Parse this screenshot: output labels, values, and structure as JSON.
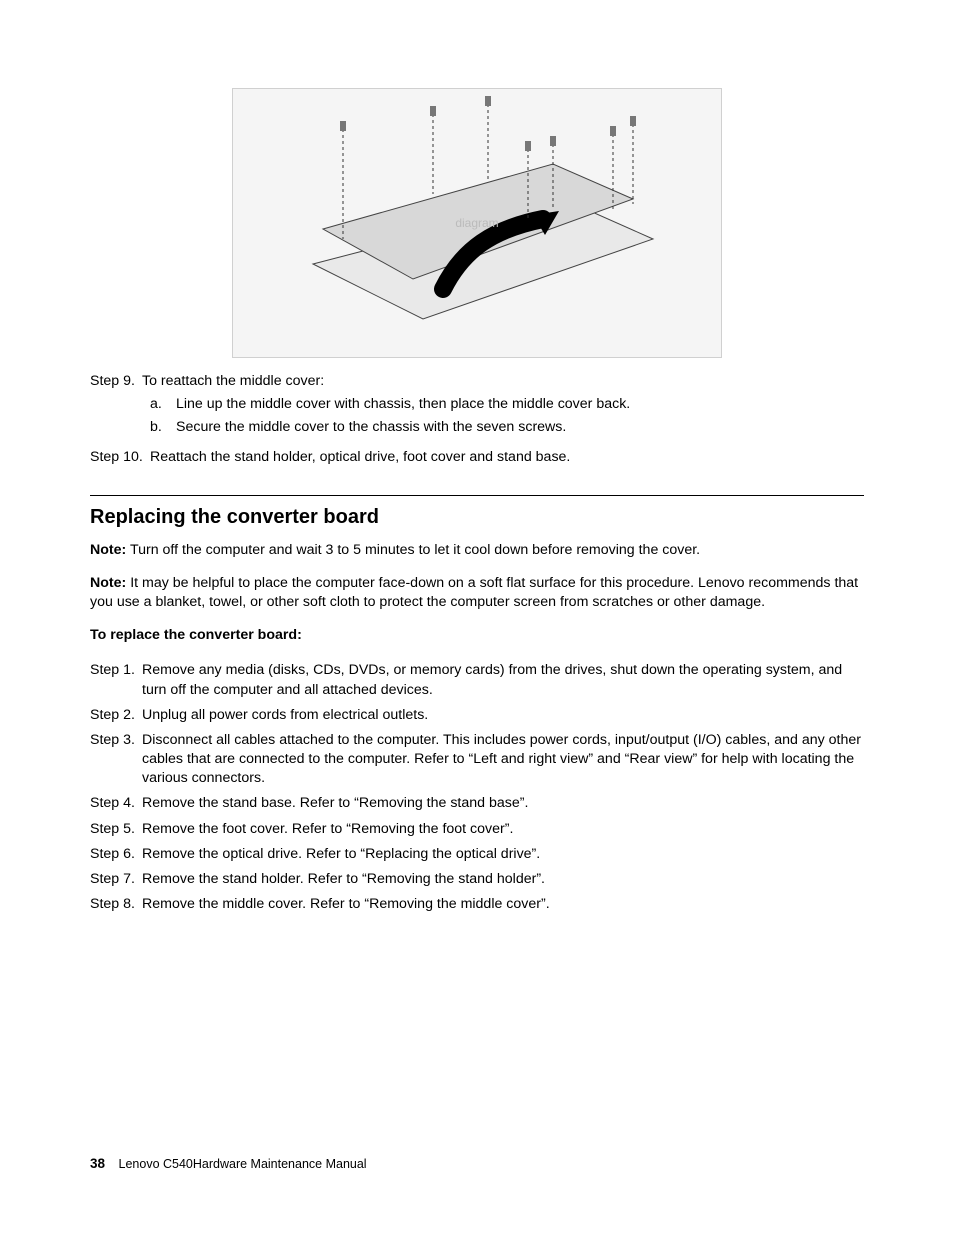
{
  "top_steps": [
    {
      "label": "Step 9.",
      "text": "To reattach the middle cover:",
      "subs": [
        {
          "label": "a.",
          "text": "Line up the middle cover with chassis, then place the middle cover back."
        },
        {
          "label": "b.",
          "text": "Secure the middle cover to the chassis with the seven screws."
        }
      ]
    },
    {
      "label": "Step 10.",
      "text": "Reattach the stand holder, optical drive, foot cover and stand base.",
      "subs": []
    }
  ],
  "section_heading": "Replacing the converter board",
  "note_label": "Note:",
  "note1": "Turn off the computer and wait 3 to 5 minutes to let it cool down before removing the cover.",
  "note2": "It may be helpful to place the computer face-down on a soft flat surface for this procedure. Lenovo recommends that you use a blanket, towel, or other soft cloth to protect the computer screen from scratches or other damage.",
  "subheading": "To replace the converter board:",
  "bottom_steps": [
    {
      "label": "Step 1.",
      "text": "Remove any media (disks, CDs, DVDs, or memory cards) from the drives, shut down the operating system, and turn off the computer and all attached devices."
    },
    {
      "label": "Step 2.",
      "text": "Unplug all power cords from electrical outlets."
    },
    {
      "label": "Step 3.",
      "text": "Disconnect all cables attached to the computer. This includes power cords, input/output (I/O) cables, and any other cables that are connected to the computer. Refer to “Left and right view” and “Rear view” for help with locating the various connectors."
    },
    {
      "label": "Step 4.",
      "text": "Remove the stand base. Refer to “Removing the stand base”."
    },
    {
      "label": "Step 5.",
      "text": "Remove the foot cover. Refer to “Removing the foot cover”."
    },
    {
      "label": "Step 6.",
      "text": "Remove the optical drive. Refer to “Replacing the optical drive”."
    },
    {
      "label": "Step 7.",
      "text": "Remove the stand holder. Refer to “Removing the stand holder”."
    },
    {
      "label": "Step 8.",
      "text": "Remove the middle cover. Refer to “Removing the middle cover”."
    }
  ],
  "footer": {
    "page_number": "38",
    "doc_title": "Lenovo C540Hardware Maintenance Manual"
  }
}
